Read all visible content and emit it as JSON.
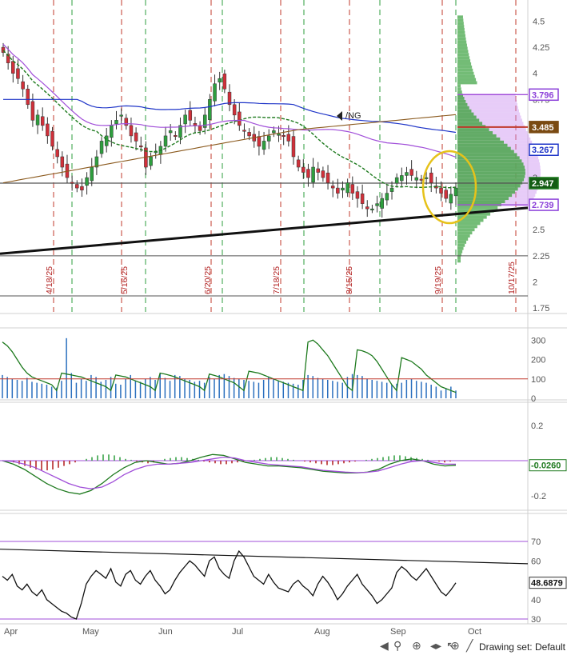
{
  "chart_data": [
    {
      "panel": "price",
      "type": "candlestick",
      "symbol": "/NG",
      "ylim": [
        1.75,
        4.6
      ],
      "yticks": [
        "4.5",
        "4.25",
        "4",
        "3.75",
        "3.5",
        "3",
        "2.5",
        "2.25",
        "2",
        "1.75"
      ],
      "date_markers": [
        "4/18/25",
        "5/16/25",
        "6/20/25",
        "7/18/25",
        "8/15/25",
        "9/19/25",
        "10/17/25"
      ],
      "price_tags": [
        {
          "value": "3.796",
          "color": "#8b3fd9",
          "text_color": "#8b3fd9",
          "bg": "#ffffff"
        },
        {
          "value": "3.485",
          "color": "#7a4a12",
          "text_color": "#ffffff",
          "bg": "#7a4a12"
        },
        {
          "value": "3.267",
          "color": "#1f35c8",
          "text_color": "#1f35c8",
          "bg": "#ffffff"
        },
        {
          "value": "2.947",
          "color": "#1e7a1e",
          "text_color": "#ffffff",
          "bg": "#145c14"
        },
        {
          "value": "2.739",
          "color": "#8b3fd9",
          "text_color": "#8b3fd9",
          "bg": "#ffffff"
        }
      ],
      "horizontal_levels": [
        2.947,
        2.25
      ],
      "trendline": {
        "from": 2.27,
        "to": 2.71
      },
      "closes": [
        4.2,
        4.1,
        4.0,
        3.95,
        3.85,
        3.7,
        3.55,
        3.6,
        3.5,
        3.4,
        3.3,
        3.2,
        3.1,
        3.0,
        2.95,
        2.9,
        2.88,
        3.0,
        3.1,
        3.2,
        3.35,
        3.4,
        3.5,
        3.55,
        3.6,
        3.5,
        3.4,
        3.35,
        3.3,
        3.1,
        3.2,
        3.25,
        3.3,
        3.4,
        3.45,
        3.4,
        3.5,
        3.6,
        3.55,
        3.5,
        3.45,
        3.6,
        3.75,
        3.9,
        3.95,
        3.85,
        3.7,
        3.6,
        3.5,
        3.45,
        3.4,
        3.35,
        3.3,
        3.35,
        3.4,
        3.45,
        3.42,
        3.4,
        3.35,
        3.2,
        3.1,
        3.05,
        3.0,
        3.1,
        3.05,
        3.0,
        2.95,
        2.9,
        2.85,
        2.9,
        2.95,
        2.85,
        2.8,
        2.75,
        2.7,
        2.7,
        2.75,
        2.8,
        2.85,
        2.9,
        3.0,
        3.02,
        3.05,
        3.02,
        3.0,
        2.98,
        3.0,
        2.95,
        2.9,
        2.85,
        2.8,
        2.84,
        2.9
      ]
    },
    {
      "panel": "volume",
      "type": "bar",
      "yticks": [
        "300",
        "200",
        "100",
        "0"
      ],
      "ylim": [
        0,
        330
      ],
      "values": [
        120,
        110,
        100,
        95,
        90,
        105,
        85,
        80,
        75,
        70,
        60,
        55,
        90,
        310,
        130,
        80,
        100,
        90,
        120,
        110,
        85,
        95,
        110,
        75,
        70,
        100,
        120,
        90,
        85,
        100,
        110,
        95,
        130,
        105,
        90,
        120,
        115,
        100,
        95,
        85,
        90,
        80,
        110,
        100,
        120,
        125,
        115,
        105,
        100,
        95,
        90,
        85,
        80,
        95,
        110,
        100,
        90,
        85,
        80,
        75,
        70,
        95,
        120,
        115,
        105,
        100,
        95,
        90,
        85,
        80,
        110,
        125,
        120,
        115,
        100,
        95,
        90,
        85,
        80,
        70,
        75,
        80,
        95,
        100,
        90,
        85,
        80,
        70,
        60,
        40,
        50,
        60,
        40
      ],
      "oi_line": [
        290,
        270,
        240,
        200,
        160,
        130,
        110,
        100,
        90,
        80,
        70,
        40,
        130,
        125,
        120,
        115,
        110,
        100,
        90,
        80,
        70,
        60,
        40,
        120,
        115,
        110,
        100,
        90,
        80,
        70,
        60,
        40,
        130,
        125,
        118,
        110,
        100,
        90,
        80,
        70,
        60,
        40,
        125,
        118,
        110,
        100,
        90,
        80,
        60,
        40,
        140,
        135,
        130,
        120,
        110,
        100,
        90,
        80,
        70,
        60,
        50,
        40,
        290,
        300,
        280,
        250,
        220,
        180,
        140,
        100,
        60,
        40,
        250,
        245,
        235,
        220,
        190,
        150,
        110,
        70,
        40,
        210,
        200,
        190,
        170,
        150,
        120,
        100,
        80,
        60,
        50,
        40,
        30
      ],
      "ref_level": 100
    },
    {
      "panel": "macd",
      "type": "histogram+lines",
      "yticks": [
        "0.2",
        "-0.2"
      ],
      "ylim": [
        -0.25,
        0.25
      ],
      "last_value": "-0.0260",
      "hist": [
        0,
        -0.005,
        -0.01,
        -0.02,
        -0.03,
        -0.04,
        -0.05,
        -0.055,
        -0.055,
        -0.05,
        -0.04,
        -0.03,
        -0.02,
        -0.01,
        0,
        0.01,
        0.02,
        0.03,
        0.035,
        0.035,
        0.03,
        0.02,
        0.01,
        0.005,
        -0.005,
        -0.01,
        -0.015,
        -0.01,
        0,
        0.01,
        0.015,
        0.02,
        0.02,
        0.015,
        0.01,
        0.005,
        -0.005,
        -0.01,
        -0.015,
        -0.02,
        -0.02,
        -0.015,
        -0.01,
        -0.005,
        0,
        0.005,
        0.01,
        0.015,
        0.02,
        0.02,
        0.015,
        0.01,
        0.005,
        0,
        -0.005,
        -0.01,
        -0.015,
        -0.02,
        -0.025,
        -0.025,
        -0.02,
        -0.015,
        -0.01,
        -0.005,
        0,
        0.005,
        0.01,
        0.015,
        0.02,
        0.025,
        0.03,
        0.03,
        0.025,
        0.02,
        0.015,
        0.01,
        0.005,
        0,
        -0.005,
        -0.01,
        -0.005,
        0
      ]
    },
    {
      "panel": "rsi",
      "type": "line",
      "yticks": [
        "70",
        "60",
        "50",
        "40",
        "30"
      ],
      "ylim": [
        28,
        75
      ],
      "last_value": "48.6879",
      "values": [
        52,
        50,
        53,
        47,
        45,
        48,
        44,
        42,
        45,
        40,
        38,
        36,
        34,
        33,
        31,
        30,
        38,
        48,
        52,
        55,
        53,
        51,
        56,
        49,
        47,
        53,
        55,
        50,
        48,
        52,
        55,
        50,
        47,
        43,
        45,
        50,
        54,
        57,
        60,
        58,
        55,
        52,
        60,
        62,
        56,
        53,
        51,
        60,
        65,
        62,
        57,
        52,
        50,
        48,
        53,
        49,
        46,
        45,
        44,
        48,
        50,
        47,
        45,
        42,
        48,
        52,
        49,
        45,
        40,
        43,
        47,
        50,
        53,
        48,
        45,
        42,
        38,
        40,
        43,
        46,
        54,
        57,
        55,
        52,
        50,
        53,
        56,
        52,
        48,
        44,
        42,
        45,
        48.7
      ]
    }
  ],
  "x_axis": {
    "months": [
      "Apr",
      "May",
      "Jun",
      "Jul",
      "Aug",
      "Sep",
      "Oct"
    ]
  },
  "toolbar": {
    "drawing_set": "Drawing set: Default"
  },
  "colors": {
    "up": "#2e9e3e",
    "down": "#d0303a",
    "ma_blue": "#1f35c8",
    "ma_purple": "#a14fd9",
    "ma_brown": "#8b5a1e",
    "ma_green": "#1e7a1e",
    "highlight": "#e6c21a",
    "profile": "#3e9e4e",
    "vah": "#c98ef0",
    "date_line_red": "#c0392b",
    "date_line_green": "#2e9e3e"
  }
}
